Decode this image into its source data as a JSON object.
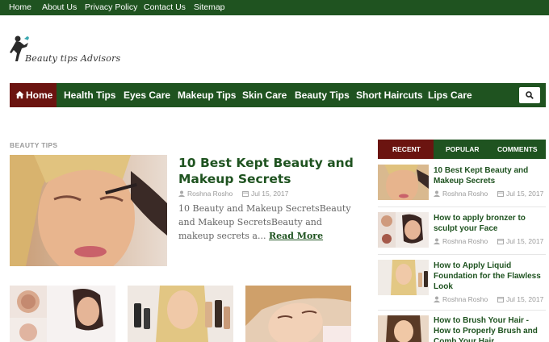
{
  "topnav": [
    "Home",
    "About Us",
    "Privacy Policy",
    "Contact Us",
    "Sitemap"
  ],
  "logo": {
    "text": "Beauty tips Advisors"
  },
  "mainnav": {
    "home": "Home",
    "items": [
      "Health Tips",
      "Eyes Care",
      "Makeup Tips",
      "Skin Care",
      "Beauty Tips",
      "Short Haircuts",
      "Lips Care"
    ]
  },
  "section_label": "BEAUTY TIPS",
  "featured": {
    "title": "10 Best Kept Beauty and Makeup Secrets",
    "author": "Roshna Rosho",
    "date": "Jul 15, 2017",
    "excerpt": "10 Beauty and Makeup SecretsBeauty and Makeup SecretsBeauty and makeup secrets a...",
    "read_more": "Read More"
  },
  "tabs": [
    "RECENT",
    "POPULAR",
    "COMMENTS"
  ],
  "recent": [
    {
      "title": "10 Best Kept Beauty and Makeup Secrets",
      "author": "Roshna Rosho",
      "date": "Jul 15, 2017"
    },
    {
      "title": "How to apply bronzer to sculpt your Face",
      "author": "Roshna Rosho",
      "date": "Jul 15, 2017"
    },
    {
      "title": "How to Apply Liquid Foundation for the Flawless Look",
      "author": "Roshna Rosho",
      "date": "Jul 15, 2017"
    },
    {
      "title": "How to Brush Your Hair - How to Properly Brush and Comb Your Hair"
    }
  ],
  "colors": {
    "nav_green": "#1f5320",
    "accent_maroon": "#6b1410",
    "title_green": "#1f5320",
    "meta_gray": "#9a9a9a"
  }
}
